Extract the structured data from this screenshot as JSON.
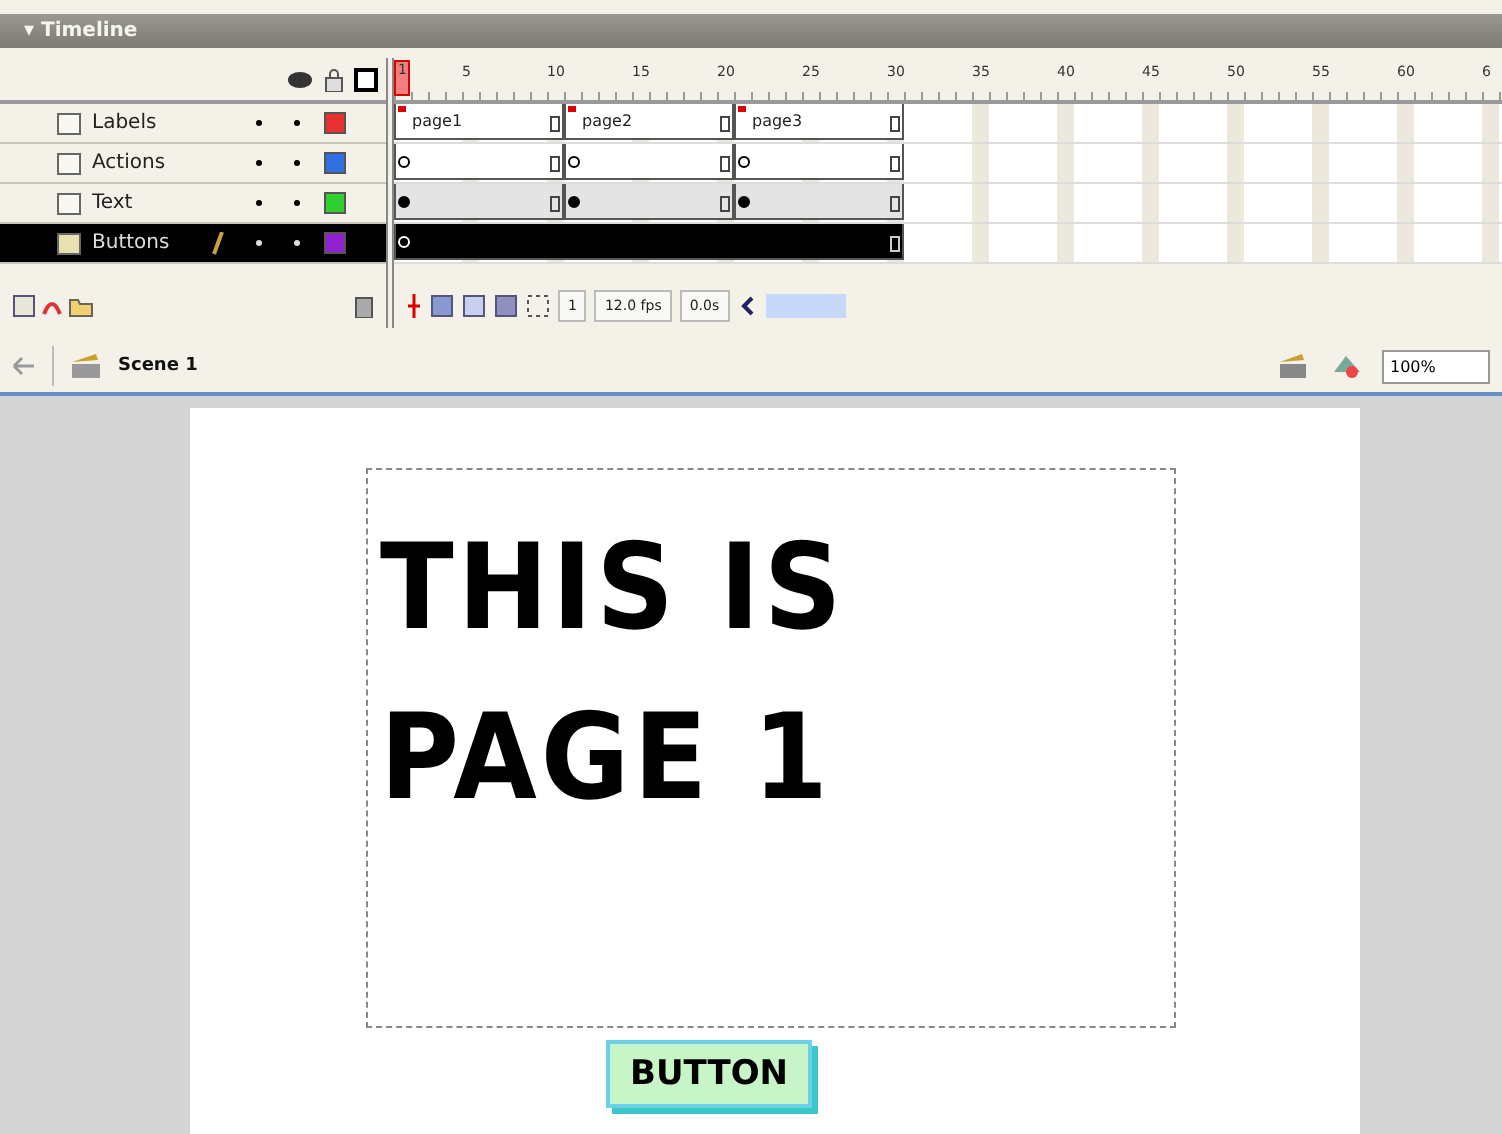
{
  "panel": {
    "title": "▾ Timeline"
  },
  "ruler": [
    "1",
    "5",
    "10",
    "15",
    "20",
    "25",
    "30",
    "35",
    "40",
    "45",
    "50",
    "55",
    "60",
    "6"
  ],
  "layers": [
    {
      "name": "Labels",
      "kind": "labels",
      "color": "#e83030",
      "selected": false,
      "editing": false,
      "segments": [
        {
          "kind": "label",
          "label": "page1"
        },
        {
          "kind": "label",
          "label": "page2"
        },
        {
          "kind": "label",
          "label": "page3"
        }
      ]
    },
    {
      "name": "Actions",
      "kind": "actions",
      "color": "#3070e0",
      "selected": false,
      "editing": false,
      "segments": [
        {
          "kind": "hollow"
        },
        {
          "kind": "hollow"
        },
        {
          "kind": "hollow"
        }
      ]
    },
    {
      "name": "Text",
      "kind": "content",
      "color": "#30d030",
      "selected": false,
      "editing": false,
      "segments": [
        {
          "kind": "filled"
        },
        {
          "kind": "filled"
        },
        {
          "kind": "filled"
        }
      ]
    },
    {
      "name": "Buttons",
      "kind": "empty",
      "color": "#9020d0",
      "selected": true,
      "editing": true,
      "segments": [
        {
          "kind": "hollow"
        }
      ]
    }
  ],
  "status": {
    "frame": "1",
    "rate": "12.0 fps",
    "time": "0.0s"
  },
  "scene": {
    "name": "Scene 1",
    "zoom": "100%"
  },
  "stage": {
    "lines": [
      "THIS IS",
      "PAGE 1"
    ],
    "button": "BUTTON"
  }
}
